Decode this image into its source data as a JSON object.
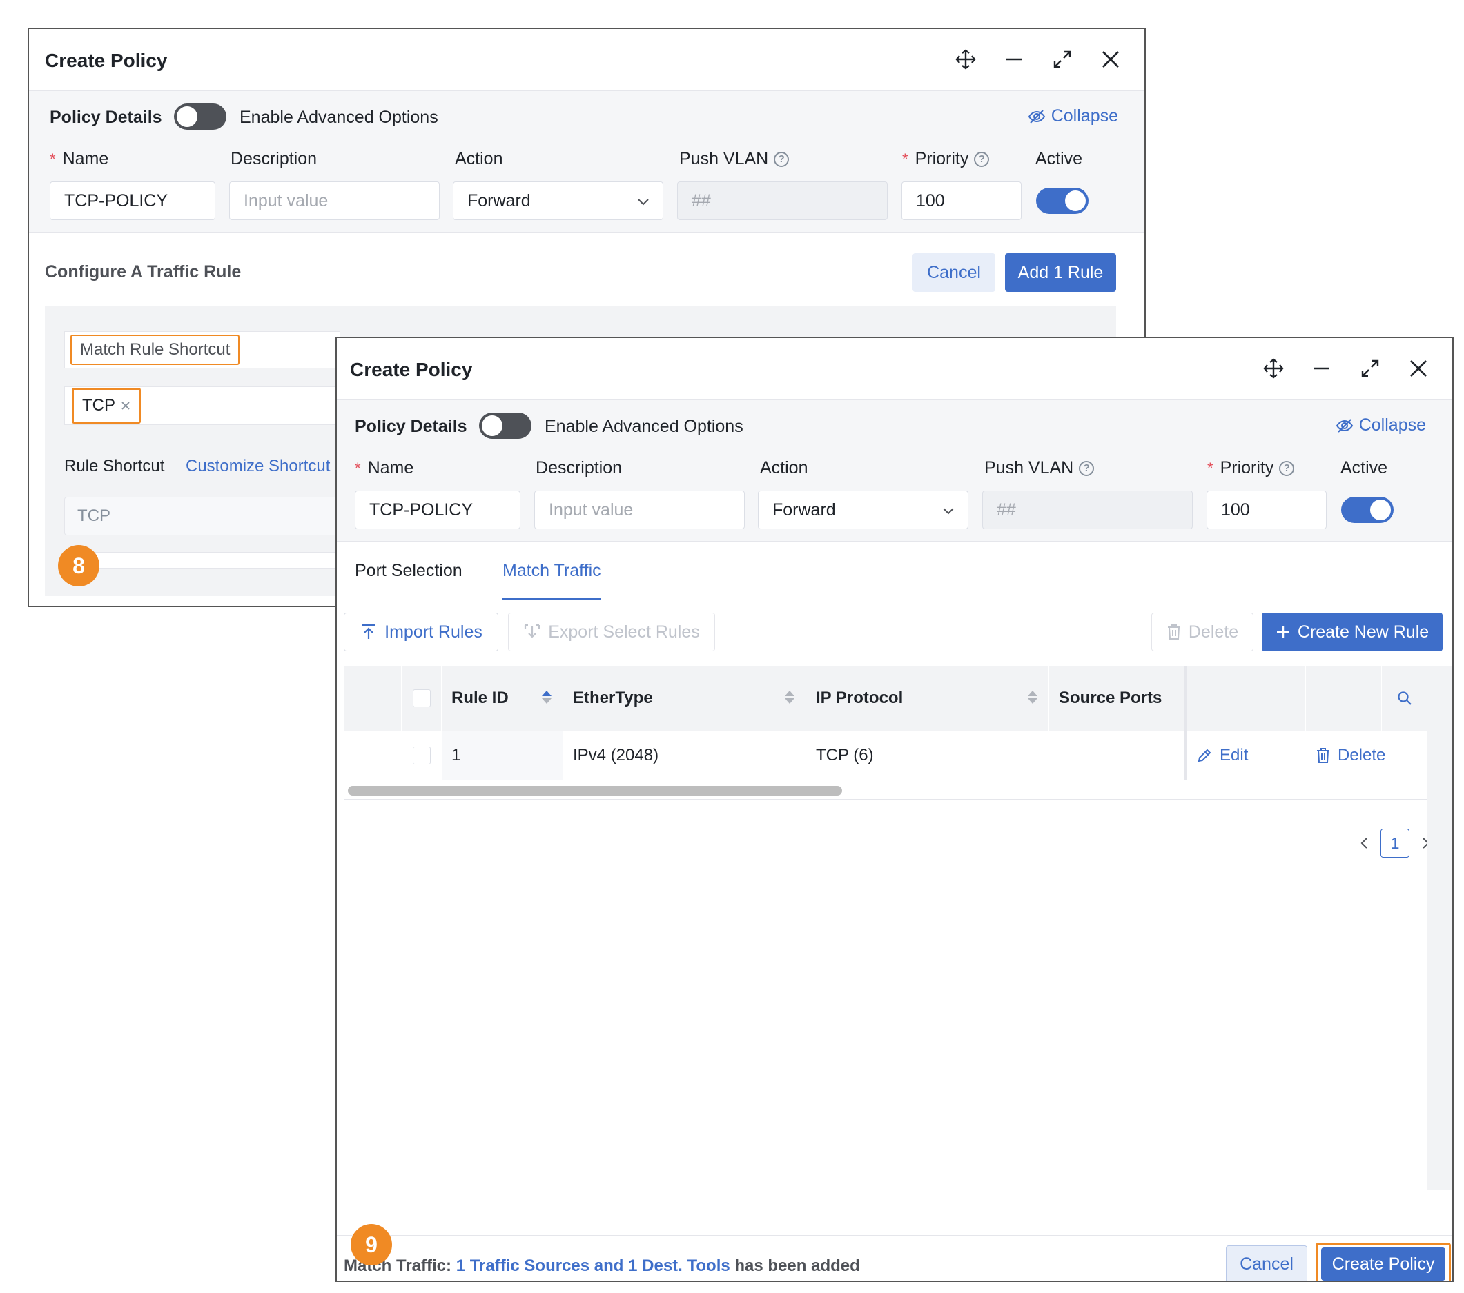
{
  "back_window": {
    "title": "Create Policy",
    "policy_details_label": "Policy Details",
    "advanced_label": "Enable Advanced Options",
    "collapse_label": "Collapse",
    "fields": {
      "name_label": "Name",
      "name_value": "TCP-POLICY",
      "description_label": "Description",
      "description_placeholder": "Input value",
      "action_label": "Action",
      "action_value": "Forward",
      "push_vlan_label": "Push VLAN",
      "push_vlan_placeholder": "##",
      "priority_label": "Priority",
      "priority_value": "100",
      "active_label": "Active"
    },
    "section_title": "Configure A Traffic Rule",
    "cancel_label": "Cancel",
    "add_rule_label": "Add 1 Rule",
    "match_rule_shortcut_label": "Match Rule Shortcut",
    "tag_tcp": "TCP",
    "rule_shortcut_label": "Rule Shortcut",
    "customize_shortcut_label": "Customize Shortcut",
    "shortcut_value": "TCP",
    "step_badge": "8"
  },
  "front_window": {
    "title": "Create Policy",
    "policy_details_label": "Policy Details",
    "advanced_label": "Enable Advanced Options",
    "collapse_label": "Collapse",
    "fields": {
      "name_label": "Name",
      "name_value": "TCP-POLICY",
      "description_label": "Description",
      "description_placeholder": "Input value",
      "action_label": "Action",
      "action_value": "Forward",
      "push_vlan_label": "Push VLAN",
      "push_vlan_placeholder": "##",
      "priority_label": "Priority",
      "priority_value": "100",
      "active_label": "Active"
    },
    "tabs": [
      "Port Selection",
      "Match Traffic"
    ],
    "toolbar": {
      "import_label": "Import Rules",
      "export_label": "Export Select Rules",
      "delete_label": "Delete",
      "create_label": "Create New Rule"
    },
    "table": {
      "columns": [
        "Rule ID",
        "EtherType",
        "IP Protocol",
        "Source Ports"
      ],
      "rows": [
        {
          "rule_id": "1",
          "ethertype": "IPv4 (2048)",
          "ip_protocol": "TCP (6)",
          "source_ports": "",
          "edit": "Edit",
          "delete": "Delete"
        }
      ]
    },
    "pagination": {
      "current_page": "1"
    },
    "footer": {
      "status_prefix": "Match Traffic:",
      "status_highlight": "1 Traffic Sources and 1 Dest. Tools",
      "status_suffix": "has been added",
      "cancel_label": "Cancel",
      "create_label": "Create Policy"
    },
    "step_badge": "9"
  },
  "colors": {
    "accent": "#3e6ec9",
    "highlight": "#f08a24",
    "required": "#e34d59"
  }
}
